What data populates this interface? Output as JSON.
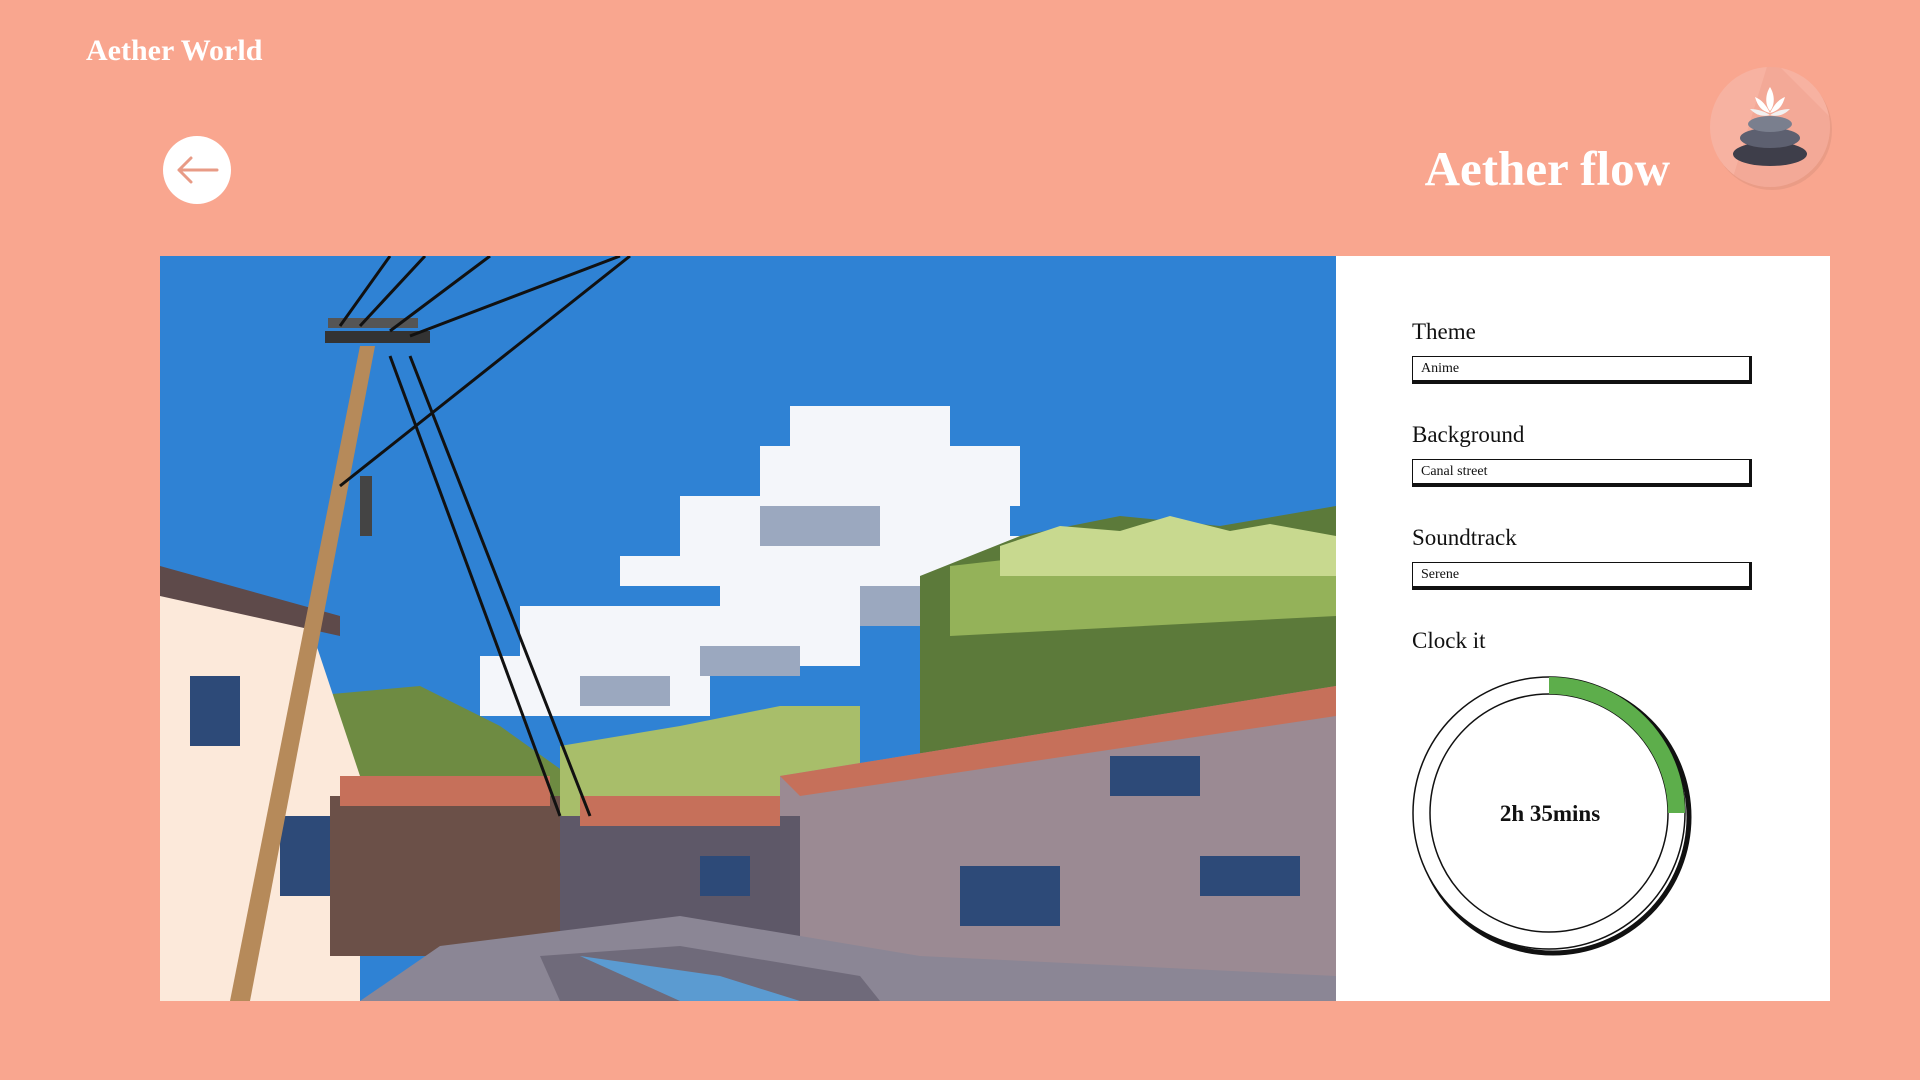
{
  "app": {
    "brand": "Aether World"
  },
  "header": {
    "title": "Aether flow",
    "back_icon": "arrow-left-icon",
    "logo_icon": "lotus-stones-icon"
  },
  "settings": {
    "theme": {
      "label": "Theme",
      "value": "Anime"
    },
    "background": {
      "label": "Background",
      "value": "Canal street"
    },
    "soundtrack": {
      "label": "Soundtrack",
      "value": "Serene"
    },
    "clock": {
      "label": "Clock it",
      "time": "2h 35mins",
      "progress": 0.25
    }
  },
  "scene": {
    "description_icon": "pixel-art-street-scene"
  },
  "colors": {
    "background": "#F9A68F",
    "accent_green": "#5DAE4B",
    "sky": "#2F82D4",
    "text": "#111111"
  }
}
